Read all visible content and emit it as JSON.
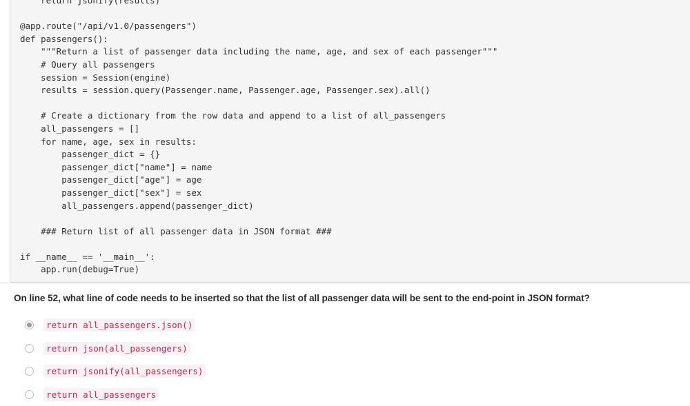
{
  "code_block": {
    "name": "python-source-code",
    "language": "python",
    "lines": [
      "    return jsonify(results)",
      "",
      "@app.route(\"/api/v1.0/passengers\")",
      "def passengers():",
      "    \"\"\"Return a list of passenger data including the name, age, and sex of each passenger\"\"\"",
      "    # Query all passengers",
      "    session = Session(engine)",
      "    results = session.query(Passenger.name, Passenger.age, Passenger.sex).all()",
      "",
      "    # Create a dictionary from the row data and append to a list of all_passengers",
      "    all_passengers = []",
      "    for name, age, sex in results:",
      "        passenger_dict = {}",
      "        passenger_dict[\"name\"] = name",
      "        passenger_dict[\"age\"] = age",
      "        passenger_dict[\"sex\"] = sex",
      "        all_passengers.append(passenger_dict)",
      "",
      "    ### Return list of all passenger data in JSON format ###",
      "",
      "if __name__ == '__main__':",
      "    app.run(debug=True)"
    ]
  },
  "quiz": {
    "question": "On line 52, what line of code needs to be inserted so that the list of all passenger data will be sent to the end-point in JSON format?",
    "options": [
      {
        "label": "return all_passengers.json()",
        "selected": true
      },
      {
        "label": "return json(all_passengers)",
        "selected": false
      },
      {
        "label": "return jsonify(all_passengers)",
        "selected": false
      },
      {
        "label": "return all_passengers",
        "selected": false
      }
    ]
  },
  "colors": {
    "code_block_bg": "#f5f5f5",
    "code_text": "#333333",
    "inline_code_text": "#c7254e",
    "inline_code_bg": "#f9f2f4",
    "border": "#dddddd",
    "radio_border": "#bdbdbd",
    "radio_dot": "#9a9a9a"
  }
}
